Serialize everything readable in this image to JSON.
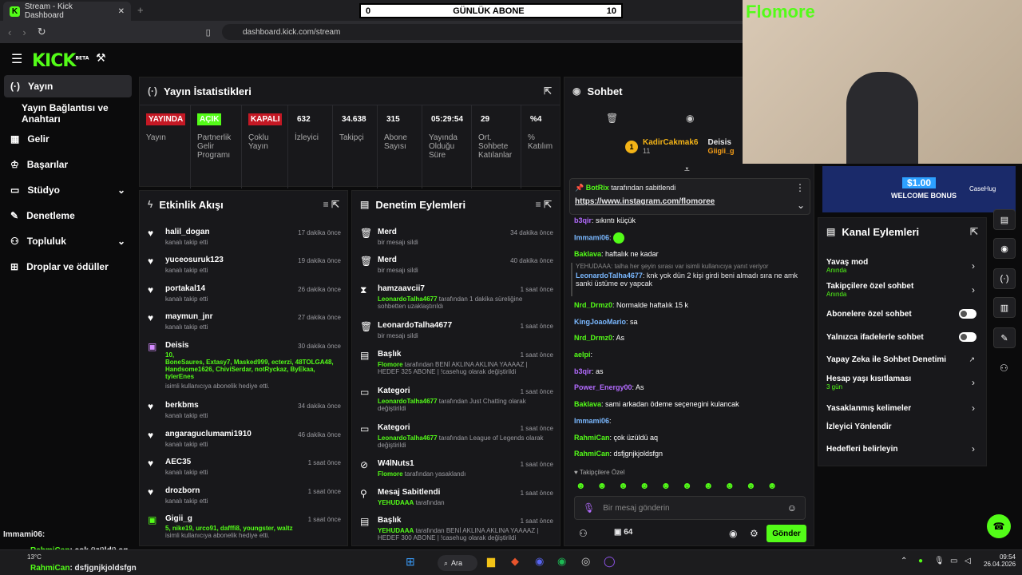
{
  "browser": {
    "tab_title": "Stream - Kick Dashboard",
    "url": "dashboard.kick.com/stream"
  },
  "overlay": {
    "score_left": "0",
    "score_title": "GÜNLÜK ABONE",
    "score_right": "10",
    "brand": "Flomore",
    "promo_amount": "$1.00",
    "promo_text": "WELCOME BONUS",
    "promo_brand": "CaseHug"
  },
  "logo": "KICK",
  "logo_badge": "BETA",
  "sidebar": {
    "items": [
      {
        "label": "Yayın",
        "icon": "broadcast-icon"
      },
      {
        "label": "Yayın Bağlantısı ve Anahtarı",
        "icon": ""
      },
      {
        "label": "Gelir",
        "icon": "money-icon"
      },
      {
        "label": "Başarılar",
        "icon": "trophy-icon"
      },
      {
        "label": "Stüdyo",
        "icon": "studio-icon"
      },
      {
        "label": "Denetleme",
        "icon": "wrench-icon"
      },
      {
        "label": "Topluluk",
        "icon": "community-icon"
      },
      {
        "label": "Droplar ve ödüller",
        "icon": "gift-icon"
      }
    ]
  },
  "stats": {
    "title": "Yayın İstatistikleri",
    "items": [
      {
        "value": "YAYINDA",
        "label": "Yayın"
      },
      {
        "value": "AÇIK",
        "label": "Partnerlik Gelir Programı"
      },
      {
        "value": "KAPALI",
        "label": "Çoklu Yayın"
      },
      {
        "value": "632",
        "label": "İzleyici"
      },
      {
        "value": "34.638",
        "label": "Takipçi"
      },
      {
        "value": "315",
        "label": "Abone Sayısı"
      },
      {
        "value": "05:29:54",
        "label": "Yayında Olduğu Süre"
      },
      {
        "value": "29",
        "label": "Ort. Sohbete Katılanlar"
      },
      {
        "value": "%4",
        "label": "% Katılım"
      }
    ]
  },
  "activity": {
    "title": "Etkinlik Akışı",
    "items": [
      {
        "name": "halil_dogan",
        "sub": "kanalı takip etti",
        "time": "17 dakika önce"
      },
      {
        "name": "yuceosuruk123",
        "sub": "kanalı takip etti",
        "time": "19 dakika önce"
      },
      {
        "name": "portakal14",
        "sub": "kanalı takip etti",
        "time": "26 dakika önce"
      },
      {
        "name": "maymun_jnr",
        "sub": "kanalı takip etti",
        "time": "27 dakika önce"
      },
      {
        "name": "Deisis",
        "count": "10,",
        "list": "BoneSaures, Extasy7, Masked999, ecterzi, 48TOLGA48, Handsome1626, ChiviSerdar, notRyckaz, ByEkaa, tylerEnes",
        "sub": "isimli kullanıcıya abonelik hediye etti.",
        "time": "30 dakika önce"
      },
      {
        "name": "berkbms",
        "sub": "kanalı takip etti",
        "time": "34 dakika önce"
      },
      {
        "name": "angaraguclumami1910",
        "sub": "kanalı takip etti",
        "time": "46 dakika önce"
      },
      {
        "name": "AEC35",
        "sub": "kanalı takip etti",
        "time": "1 saat önce"
      },
      {
        "name": "drozborn",
        "sub": "kanalı takip etti",
        "time": "1 saat önce"
      },
      {
        "name": "Gigii_g",
        "list": "5, nike19, urco91, dafffi8, youngster, waltz",
        "sub": "isimli kullanıcıya abonelik hediye etti.",
        "time": "1 saat önce"
      }
    ]
  },
  "moderation": {
    "title": "Denetim Eylemleri",
    "items": [
      {
        "name": "Merd",
        "sub": "bir mesajı sildi",
        "time": "34 dakika önce"
      },
      {
        "name": "Merd",
        "sub": "bir mesajı sildi",
        "time": "40 dakika önce"
      },
      {
        "name": "hamzaavcii7",
        "actor": "LeonardoTalha4677",
        "sub": "tarafından 1 dakika süreliğine sohbetten uzaklaştırıldı",
        "time": "1 saat önce"
      },
      {
        "name": "LeonardoTalha4677",
        "sub": "bir mesajı sildi",
        "time": "1 saat önce"
      },
      {
        "name": "Başlık",
        "actor": "Flomore",
        "sub": "tarafından BENİ AKLINA AKLINA YAAAAZ | HEDEF 325 ABONE | !casehug olarak değiştirildi",
        "time": "1 saat önce"
      },
      {
        "name": "Kategori",
        "actor": "LeonardoTalha4677",
        "sub": "tarafından Just Chatting olarak değiştirildi",
        "time": "1 saat önce"
      },
      {
        "name": "Kategori",
        "actor": "LeonardoTalha4677",
        "sub": "tarafından League of Legends olarak değiştirildi",
        "time": "1 saat önce"
      },
      {
        "name": "W4lNuts1",
        "actor": "Flomore",
        "sub": "tarafından yasaklandı",
        "time": "1 saat önce"
      },
      {
        "name": "Mesaj Sabitlendi",
        "actor": "YEHUDAAA",
        "sub": "tarafından",
        "time": "1 saat önce"
      },
      {
        "name": "Başlık",
        "actor": "YEHUDAAA",
        "sub": "tarafından BENİ AKLINA AKLINA YAAAAZ | HEDEF 300 ABONE | !casehug olarak değiştirildi",
        "time": "1 saat önce"
      }
    ]
  },
  "chat": {
    "title": "Sohbet",
    "top_user": "KadirCakmak6",
    "top_count": "11",
    "top2": "Deisis",
    "top3": "Giigii_g",
    "pinned_by": "BotRix",
    "pinned_suffix": "tarafından sabitlendi",
    "pinned_link": "https://www.instagram.com/flomoree",
    "messages": [
      {
        "user": "b3qir",
        "text": ": sıkıntı küçük",
        "color": "#b36bff"
      },
      {
        "user": "Immami06",
        "text": ":",
        "color": "#7ab8ff"
      },
      {
        "user": "Baklava",
        "text": ": haftalık ne kadar",
        "color": "#53fc18"
      },
      {
        "user": "LeonardoTalha4677",
        "reply": "YEHUDAAA: talha her şeyin sırası var isimli kullanıcıya yanıt veriyor",
        "text": ": knk yok dün 2 kişi girdi beni almadı sıra ne amk sanki üstüme ev yapcak",
        "color": "#7ab8ff"
      },
      {
        "user": "Nrd_Drmz0",
        "text": ": Normalde haftalık 15 k",
        "color": "#53fc18"
      },
      {
        "user": "KingJoaoMario",
        "text": ": sa",
        "color": "#7ab8ff"
      },
      {
        "user": "Nrd_Drmz0",
        "text": ": As",
        "color": "#53fc18"
      },
      {
        "user": "aelpi",
        "text": ":",
        "color": "#53fc18"
      },
      {
        "user": "b3qir",
        "text": ": as",
        "color": "#b36bff"
      },
      {
        "user": "Power_Energy00",
        "text": ": As",
        "color": "#b36bff"
      },
      {
        "user": "Baklava",
        "text": ": sami arkadan ödeme seçenegini kulancak",
        "color": "#53fc18"
      },
      {
        "user": "Immami06",
        "text": ":",
        "color": "#7ab8ff"
      },
      {
        "user": "RahmiCan",
        "text": ": çok üzüldü aq",
        "color": "#53fc18"
      },
      {
        "user": "RahmiCan",
        "text": ": dsfjgnjkjoldsfgn",
        "color": "#53fc18"
      }
    ],
    "followers_only": "Takipçilere Özel",
    "input_placeholder": "Bir mesaj gönderin",
    "viewer_count": "64",
    "send": "Gönder"
  },
  "channel_actions": {
    "title": "Kanal Eylemleri",
    "items": [
      {
        "label": "Yavaş mod",
        "sub": "Anında",
        "type": "arrow"
      },
      {
        "label": "Takipçilere özel sohbet",
        "sub": "Anında",
        "type": "arrow"
      },
      {
        "label": "Abonelere özel sohbet",
        "sub": "",
        "type": "toggle"
      },
      {
        "label": "Yalnızca ifadelerle sohbet",
        "sub": "",
        "type": "toggle"
      },
      {
        "label": "Yapay Zeka ile Sohbet Denetimi",
        "sub": "",
        "type": "external"
      },
      {
        "label": "Hesap yaşı kısıtlaması",
        "sub": "3 gün",
        "type": "arrow"
      },
      {
        "label": "Yasaklanmış kelimeler",
        "sub": "",
        "type": "arrow"
      },
      {
        "label": "İzleyici Yönlendir",
        "sub": "",
        "type": "none"
      },
      {
        "label": "Hedefleri belirleyin",
        "sub": "",
        "type": "arrow"
      }
    ]
  },
  "overlay_chat": [
    {
      "user": "Immami06",
      "text": ":"
    },
    {
      "user": "RahmiCan",
      "text": ": çok üzüldü aq"
    },
    {
      "user": "RahmiCan",
      "text": ": dsfjgnjkjoldsfgn"
    }
  ],
  "taskbar": {
    "weather": "13°C",
    "search": "Ara",
    "time": "09:54",
    "date": "26.04.2026"
  }
}
